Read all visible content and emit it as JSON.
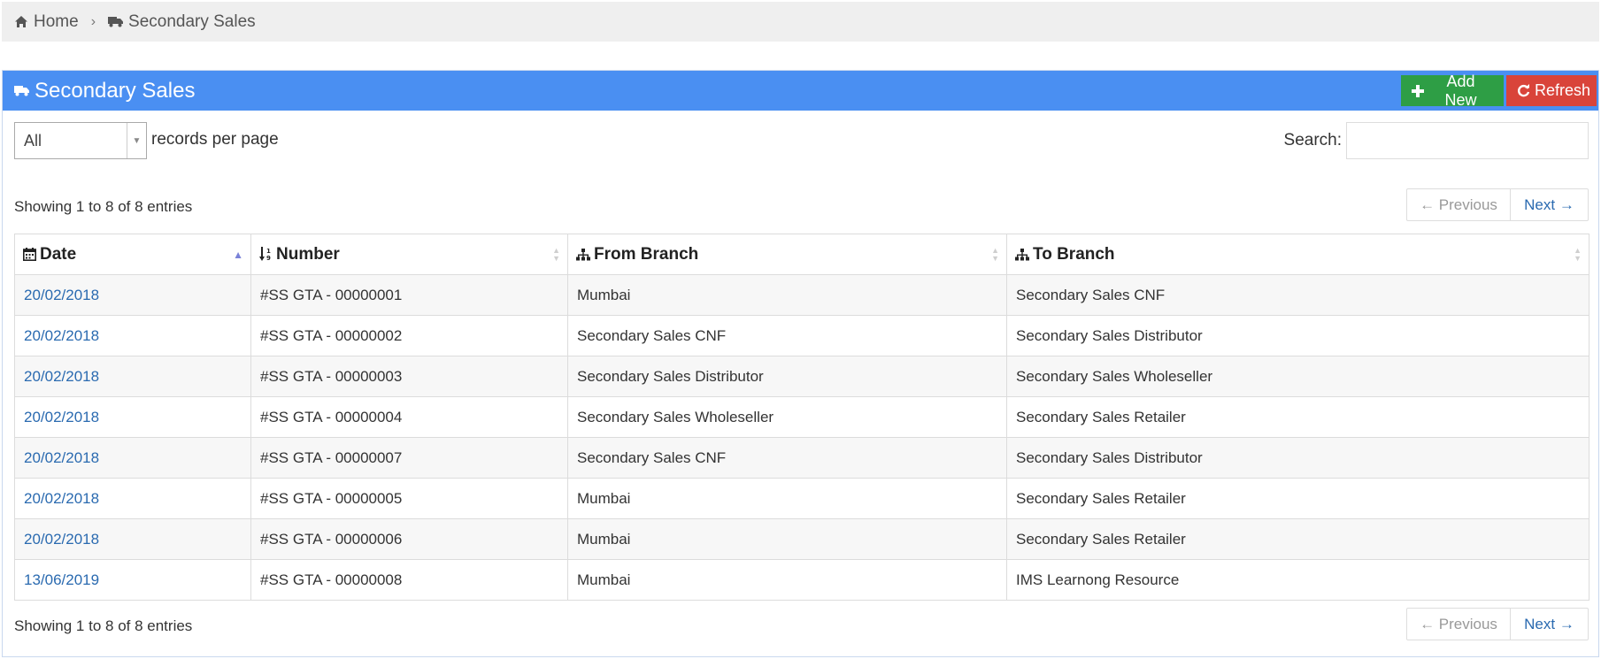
{
  "breadcrumb": {
    "home_label": "Home",
    "separator": "›",
    "current_label": "Secondary Sales"
  },
  "panel": {
    "title": "Secondary Sales",
    "add_new_label": "Add New",
    "refresh_label": "Refresh",
    "colors": {
      "heading": "#4a8ff2",
      "add": "#2e9e45",
      "refresh": "#d9443a"
    }
  },
  "length": {
    "selected": "All",
    "label": "records per page"
  },
  "search": {
    "label": "Search:",
    "value": ""
  },
  "info": {
    "top": "Showing 1 to 8 of 8 entries",
    "bottom": "Showing 1 to 8 of 8 entries"
  },
  "pagination": {
    "previous_label": "← Previous",
    "next_label": "Next →"
  },
  "table": {
    "columns": [
      {
        "label": "Date",
        "icon": "calendar-icon"
      },
      {
        "label": "Number",
        "icon": "sort-numeric-icon"
      },
      {
        "label": "From Branch",
        "icon": "sitemap-icon"
      },
      {
        "label": "To Branch",
        "icon": "sitemap-icon"
      }
    ],
    "rows": [
      {
        "date": "20/02/2018",
        "number": "#SS GTA - 00000001",
        "from": "Mumbai",
        "to": "Secondary Sales CNF"
      },
      {
        "date": "20/02/2018",
        "number": "#SS GTA - 00000002",
        "from": "Secondary Sales CNF",
        "to": "Secondary Sales Distributor"
      },
      {
        "date": "20/02/2018",
        "number": "#SS GTA - 00000003",
        "from": "Secondary Sales Distributor",
        "to": "Secondary Sales Wholeseller"
      },
      {
        "date": "20/02/2018",
        "number": "#SS GTA - 00000004",
        "from": "Secondary Sales Wholeseller",
        "to": "Secondary Sales Retailer"
      },
      {
        "date": "20/02/2018",
        "number": "#SS GTA - 00000007",
        "from": "Secondary Sales CNF",
        "to": "Secondary Sales Distributor"
      },
      {
        "date": "20/02/2018",
        "number": "#SS GTA - 00000005",
        "from": "Mumbai",
        "to": "Secondary Sales Retailer"
      },
      {
        "date": "20/02/2018",
        "number": "#SS GTA - 00000006",
        "from": "Mumbai",
        "to": "Secondary Sales Retailer"
      },
      {
        "date": "13/06/2019",
        "number": "#SS GTA - 00000008",
        "from": "Mumbai",
        "to": "IMS Learnong Resource"
      }
    ]
  }
}
